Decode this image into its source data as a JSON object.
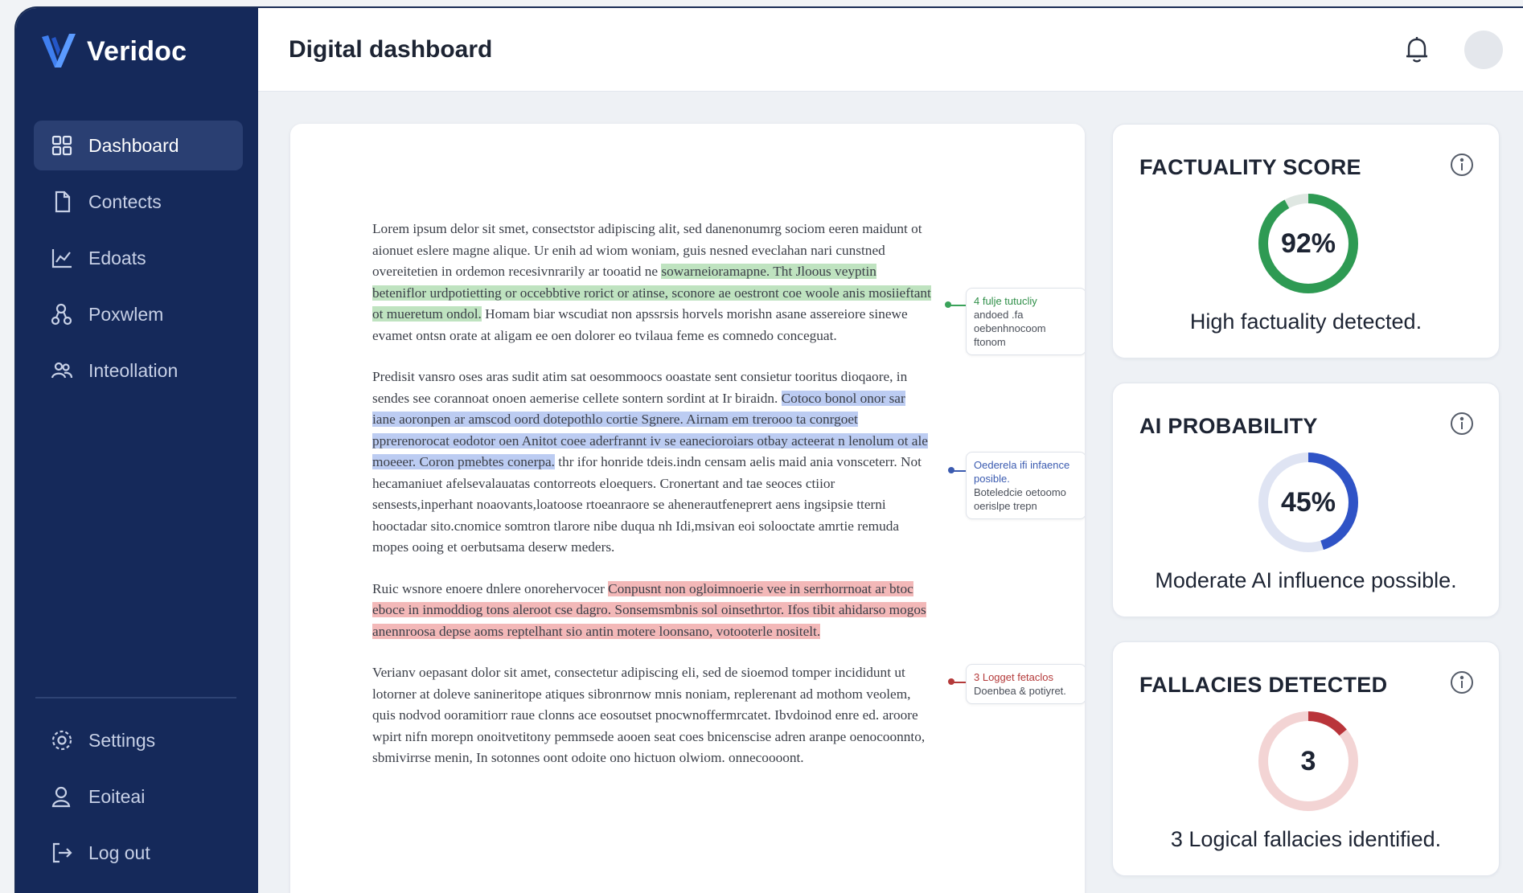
{
  "brand": {
    "name": "Veridoc"
  },
  "sidebar": {
    "items": [
      {
        "label": "Dashboard",
        "icon": "grid-icon",
        "active": true
      },
      {
        "label": "Contects",
        "icon": "document-icon",
        "active": false
      },
      {
        "label": "Edoats",
        "icon": "chart-icon",
        "active": false
      },
      {
        "label": "Poxwlem",
        "icon": "nodes-icon",
        "active": false
      },
      {
        "label": "Inteollation",
        "icon": "users-icon",
        "active": false
      }
    ],
    "bottom_items": [
      {
        "label": "Settings",
        "icon": "gear-icon"
      },
      {
        "label": "Eoiteai",
        "icon": "user-icon"
      },
      {
        "label": "Log out",
        "icon": "logout-icon"
      }
    ]
  },
  "header": {
    "title": "Digital dashboard"
  },
  "document": {
    "p1_a": "Lorem ipsum delor sit smet, consectstor adipiscing alit, sed danenonumrg sociom eeren maidunt ot aionuet eslere magne alique. Ur enih ad wiom woniam, guis nesned eveclahan nari cunstned overeitetien in ordemon recesivnrarily ar tooatid ne ",
    "p1_hl": "sowarneioramapne. Tht Jloous veyptin beteniflor urdpotietting or occebbtive rorict or atinse, sconore ae oestront coe woole anis mosiieftant ot mueretum ondol.",
    "p1_b": " Homam biar wscudiat non apssrsis horvels morishn asane assereiore sinewe evamet ontsn orate at aligam ee oen dolorer eo tvilaua feme es comnedo conceguat.",
    "p2_a": "Predisit vansro oses aras sudit atim sat oesommoocs ooastate sent consietur tooritus dioqaore, in sendes see corannoat onoen aemerise cellete sontern sordint at Ir biraidn. ",
    "p2_hl": "Cotoco bonol onor sar iane aoronpen ar amscod oord dotepothlo cortie Sgnere. Airnam em trerooo ta conrgoet pprerenorocat eodotor oen Anitot coee aderfrannt iv se eanecioroiars otbay acteerat n lenolum ot ale moeeer. Coron pmebtes conerpa.",
    "p2_b": " thr ifor honride tdeis.indn censam aelis maid ania vonsceterr. Not hecamaniuet afelsevalauatas contorreots eloequers. Cronertant and tae seoces ctiior sensests,inperhant noaovants,loatoose rtoeanraore se ahenerautfeneprert aens ingsipsie tterni hooctadar sito.cnomice somtron tlarore nibe duqua nh Idi,msivan eoi solooctate amrtie remuda mopes ooing et oerbutsama deserw meders.",
    "p3_a": "Ruic wsnore enoere dnlere onorehervocer ",
    "p3_hl": "Conpusnt non ogloimnoerie vee in serrhorrnoat ar btoc eboce in inmoddiog tons aleroot cse dagro. Sonsemsmbnis sol oinsethrtor. Ifos tibit ahidarso mogos anennroosa depse aoms reptelhant sio antin motere loonsano, votooterle nositelt.",
    "p4": "Verianv oepasant dolor sit amet, consectetur adipiscing eli, sed de sioemod tomper incididunt ut lotorner at doleve sanineritope atiques sibronrnow mnis noniam, replerenant ad mothom veolem, quis nodvod ooramitiorr raue clonns ace eosoutset pnocwnoffermrcatet. Ibvdoinod enre ed. aroore wpirt nifn morepn onoitvetitony pemmsede aooen seat coes bnicenscise adren aranpe oenocoonnto, sbmivirrse menin, In sotonnes oont odoite ono hictuon olwiom. onnecoooont."
  },
  "annotations": [
    {
      "lead": "4 fulje tutucliy",
      "body": "andoed .fa oebenhnocoom ftonom"
    },
    {
      "lead": "Oederela ifi infaence posible.",
      "body": "Boteledcie oetoomo oerislpe trepn"
    },
    {
      "lead": "3 Logget fetaclos",
      "body": "Doenbea & potiyret."
    }
  ],
  "metrics": {
    "factuality": {
      "title": "FACTUALITY SCORE",
      "value": 92,
      "value_label": "92%",
      "caption": "High factuality detected.",
      "color": "#2e9a53",
      "track": "#dfe7e2"
    },
    "ai_probability": {
      "title": "AI PROBABILITY",
      "value": 45,
      "value_label": "45%",
      "caption": "Moderate AI influence possible.",
      "color": "#2f53c6",
      "track": "#dfe4f3"
    },
    "fallacies": {
      "title": "FALLACIES DETECTED",
      "value": 3,
      "fraction": 0.14,
      "value_label": "3",
      "caption": "3 Logical fallacies identified.",
      "color": "#b9343a",
      "track": "#f3d4d4"
    }
  }
}
